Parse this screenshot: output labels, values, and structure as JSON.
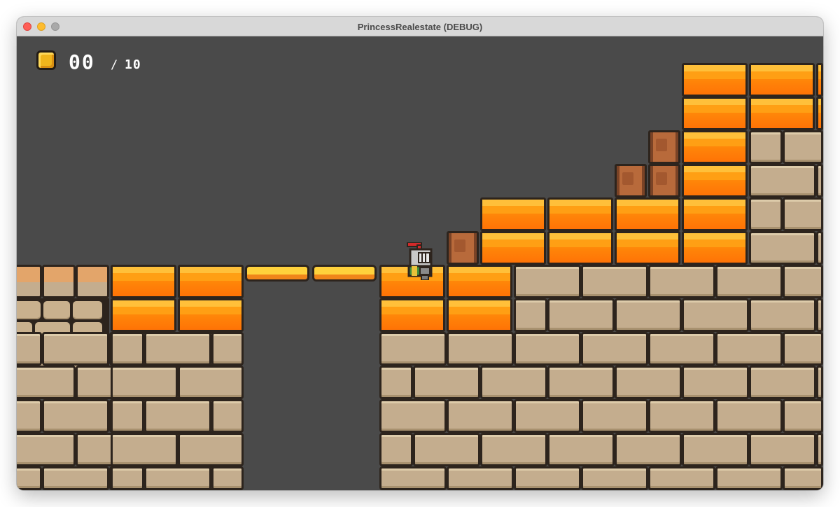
{
  "window": {
    "title": "PrincessRealestate (DEBUG)"
  },
  "hud": {
    "coins_collected": "00",
    "separator": "/",
    "coins_total": "10"
  },
  "colors": {
    "background": "#4a4a4a",
    "lava": "#ff8a10",
    "stone": "#c4ad8e",
    "outline": "#2d241d",
    "coin": "#f0b51c"
  },
  "icons": {
    "coin": "coin-icon",
    "player": "knight-sprite"
  }
}
